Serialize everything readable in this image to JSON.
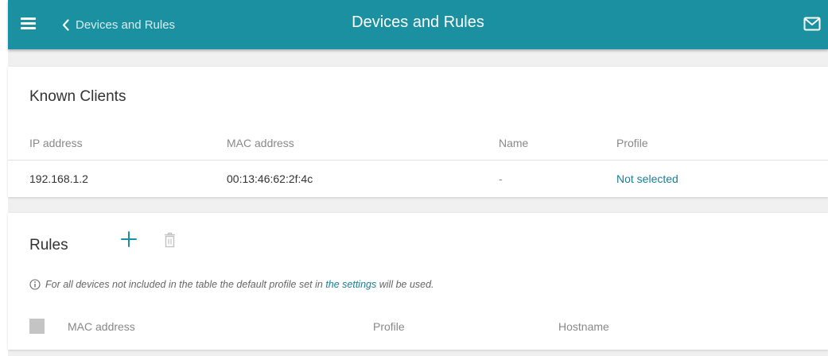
{
  "header": {
    "back_label": "Devices and Rules",
    "title": "Devices and Rules",
    "accent_color": "#1a90a1"
  },
  "known_clients": {
    "title": "Known Clients",
    "columns": [
      "IP address",
      "MAC address",
      "Name",
      "Profile"
    ],
    "rows": [
      {
        "ip": "192.168.1.2",
        "mac": "00:13:46:62:2f:4c",
        "name": "-",
        "profile": "Not selected"
      }
    ]
  },
  "rules": {
    "title": "Rules",
    "info_prefix": "For all devices not included in the table the default profile set in",
    "info_link": "the settings",
    "info_suffix": "will be used.",
    "columns": [
      "MAC address",
      "Profile",
      "Hostname"
    ]
  },
  "icons": {
    "menu": "hamburger-icon",
    "back": "chevron-left-icon",
    "mail": "mail-icon",
    "add": "plus-icon",
    "delete": "trash-icon",
    "info": "info-icon"
  }
}
